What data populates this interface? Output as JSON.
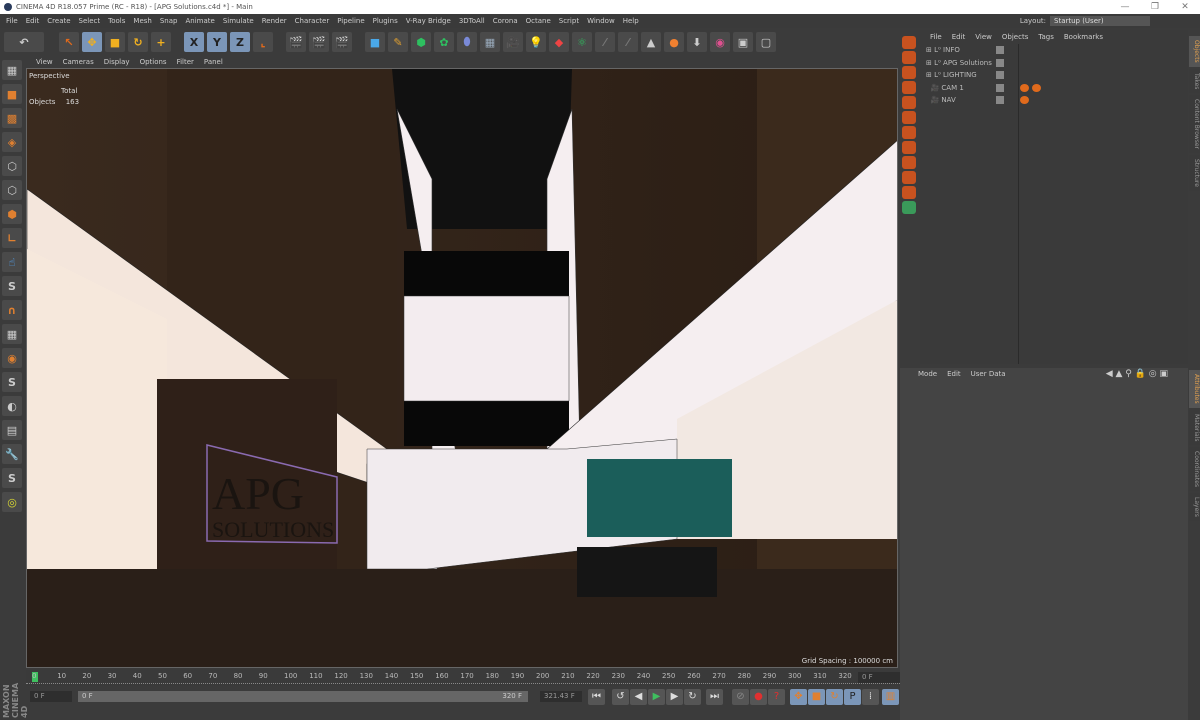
{
  "window": {
    "title": "CINEMA 4D R18.057 Prime (RC - R18) - [APG Solutions.c4d *] - Main",
    "controls": [
      "—",
      "❐",
      "✕"
    ]
  },
  "menu": [
    "File",
    "Edit",
    "Create",
    "Select",
    "Tools",
    "Mesh",
    "Snap",
    "Animate",
    "Simulate",
    "Render",
    "Character",
    "Pipeline",
    "Plugins",
    "V-Ray Bridge",
    "3DToAll",
    "Corona",
    "Octane",
    "Script",
    "Window",
    "Help"
  ],
  "layout": {
    "label": "Layout:",
    "value": "Startup (User)"
  },
  "toolbar": {
    "undo": "↶",
    "axes": [
      "X",
      "Y",
      "Z"
    ]
  },
  "viewport": {
    "menu": [
      "View",
      "Cameras",
      "Display",
      "Options",
      "Filter",
      "Panel"
    ],
    "camera": "Perspective",
    "hud": {
      "col": "Total",
      "row": "Objects",
      "value": "163"
    },
    "grid_spacing": "Grid Spacing : 100000 cm",
    "sign_text": [
      "APG",
      "SOLUTIONS"
    ]
  },
  "timeline": {
    "ticks": [
      "0",
      "10",
      "20",
      "30",
      "40",
      "50",
      "60",
      "70",
      "80",
      "90",
      "100",
      "110",
      "120",
      "130",
      "140",
      "150",
      "160",
      "170",
      "180",
      "190",
      "200",
      "210",
      "220",
      "230",
      "240",
      "250",
      "260",
      "270",
      "280",
      "290",
      "300",
      "310",
      "320"
    ],
    "current": "0 F"
  },
  "frames": {
    "start": "0 F",
    "range_start": "0 F",
    "range_end": "320 F",
    "end": "321.43 F",
    "current": "0 F"
  },
  "objects": {
    "menu": [
      "File",
      "Edit",
      "View",
      "Objects",
      "Tags",
      "Bookmarks"
    ],
    "items": [
      {
        "name": "INFO"
      },
      {
        "name": "APG Solutions"
      },
      {
        "name": "LIGHTING"
      },
      {
        "name": "CAM 1"
      },
      {
        "name": "NAV"
      }
    ]
  },
  "attributes": {
    "menu": [
      "Mode",
      "Edit",
      "User Data"
    ]
  },
  "right_tabs_top": [
    "Objects",
    "Takes",
    "Content Browser",
    "Structure"
  ],
  "right_tabs_bottom": [
    "Attributes",
    "Materials",
    "Coordinates",
    "Layers"
  ],
  "branding": "MAXON CINEMA 4D",
  "colors": {
    "accent": "#e06a1c",
    "play": "#3fbf5f",
    "selected_tool": "#7b96b8"
  }
}
